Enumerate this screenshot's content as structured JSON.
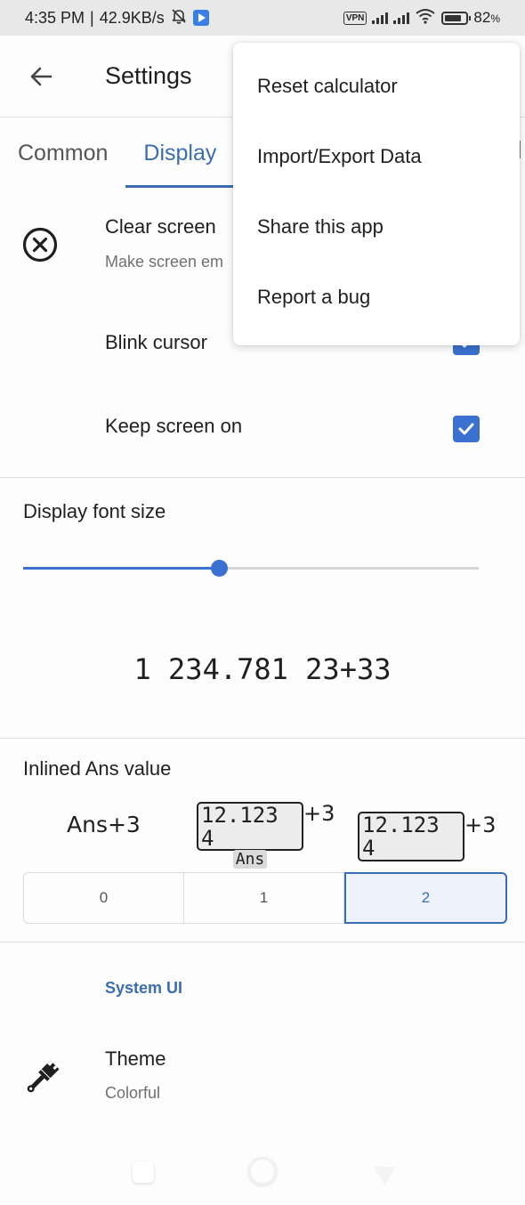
{
  "status_bar": {
    "time": "4:35 PM",
    "separator": "|",
    "net_speed": "42.9KB/s",
    "icons": [
      "mute-bell-icon",
      "play-app-icon",
      "vpn-icon",
      "signal-icon",
      "signal-icon",
      "wifi-icon",
      "battery-icon"
    ],
    "vpn_label": "VPN",
    "battery_percent": "82",
    "battery_suffix": "%",
    "battery_level": 0.82
  },
  "app_bar": {
    "back_icon": "arrow-left-icon",
    "title": "Settings"
  },
  "tabs": [
    {
      "label": "Common",
      "active": false
    },
    {
      "label": "Display",
      "active": true
    }
  ],
  "settings": {
    "clear_screen": {
      "icon": "circle-x-icon",
      "title": "Clear screen",
      "subtitle": "Make screen em"
    },
    "blink_cursor": {
      "title": "Blink cursor",
      "checked": true
    },
    "keep_screen_on": {
      "title": "Keep screen on",
      "checked": true
    },
    "display_font_size": {
      "title": "Display font size",
      "slider_value_fraction": 0.43,
      "preview_text": "1 234.781 23+33"
    },
    "inlined_ans": {
      "title": "Inlined Ans value",
      "option0": {
        "text": "Ans+3"
      },
      "option1": {
        "value": "12.123 4",
        "label": "Ans",
        "suffix": "+3"
      },
      "option2": {
        "value": "12.123 4",
        "suffix": "+3"
      },
      "segments": [
        "0",
        "1",
        "2"
      ],
      "selected_segment": "2"
    },
    "system_ui_category": "System UI",
    "theme": {
      "icon": "paint-brush-icon",
      "title": "Theme",
      "subtitle": "Colorful"
    }
  },
  "overflow_menu": {
    "items": [
      "Reset calculator",
      "Import/Export Data",
      "Share this app",
      "Report a bug"
    ]
  },
  "nav_bar": {
    "buttons": [
      "recents-icon",
      "home-icon",
      "back-icon"
    ]
  },
  "colors": {
    "accent": "#3b6db3",
    "checkbox": "#3a70cf"
  }
}
